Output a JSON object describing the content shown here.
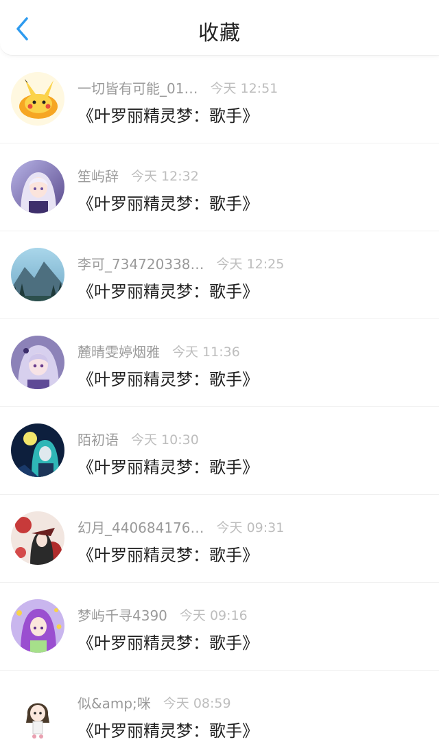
{
  "header": {
    "title": "收藏",
    "back_icon": "chevron-left-icon",
    "accent": "#2E9BEF"
  },
  "items": [
    {
      "name": "一切皆有可能_01…",
      "time": "今天 12:51",
      "content": "《叶罗丽精灵梦：歌手》",
      "avatar": "pikachu-avatar"
    },
    {
      "name": "笙屿辞",
      "time": "今天 12:32",
      "content": "《叶罗丽精灵梦：歌手》",
      "avatar": "anime-girl-avatar"
    },
    {
      "name": "李可_734720338…",
      "time": "今天 12:25",
      "content": "《叶罗丽精灵梦：歌手》",
      "avatar": "mountain-landscape-avatar"
    },
    {
      "name": "麓晴雯婷烟雅",
      "time": "今天 11:36",
      "content": "《叶罗丽精灵梦：歌手》",
      "avatar": "anime-girl-avatar"
    },
    {
      "name": "陌初语",
      "time": "今天 10:30",
      "content": "《叶罗丽精灵梦：歌手》",
      "avatar": "anime-night-avatar"
    },
    {
      "name": "幻月_440684176…",
      "time": "今天 09:31",
      "content": "《叶罗丽精灵梦：歌手》",
      "avatar": "anime-flower-avatar"
    },
    {
      "name": "梦屿千寻4390",
      "time": "今天 09:16",
      "content": "《叶罗丽精灵梦：歌手》",
      "avatar": "anime-purple-hair-avatar"
    },
    {
      "name": "似&amp;咪",
      "time": "今天 08:59",
      "content": "《叶罗丽精灵梦：歌手》",
      "avatar": "chibi-girl-avatar"
    }
  ]
}
